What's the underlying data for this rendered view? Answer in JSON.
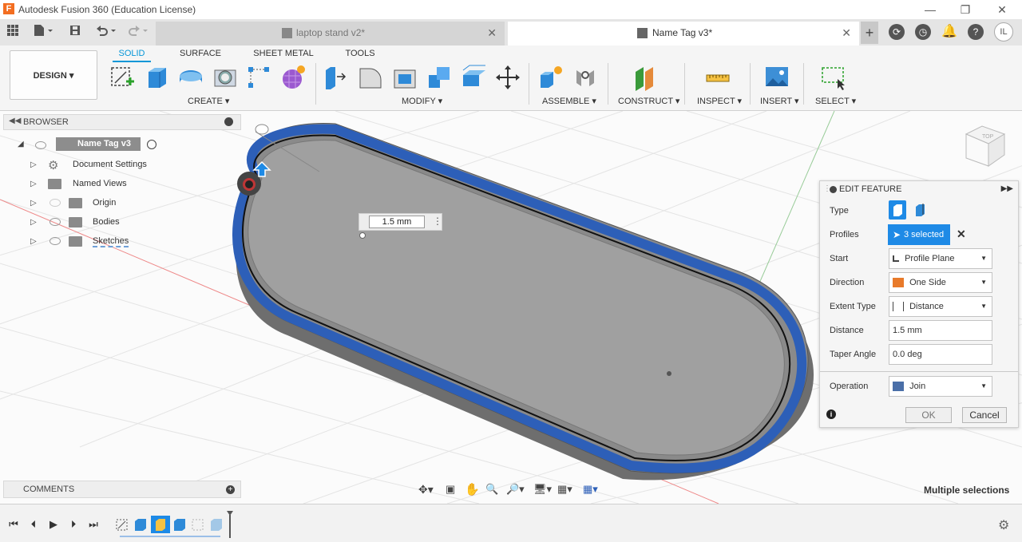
{
  "window": {
    "title": "Autodesk Fusion 360 (Education License)",
    "app_icon": "F"
  },
  "tabs": [
    {
      "label": "laptop stand v2*",
      "active": false
    },
    {
      "label": "Name Tag v3*",
      "active": true
    }
  ],
  "user_initials": "IL",
  "toolbar": {
    "workspace": "DESIGN",
    "workspace_tabs": [
      "SOLID",
      "SURFACE",
      "SHEET METAL",
      "TOOLS"
    ],
    "groups": [
      "CREATE",
      "MODIFY",
      "ASSEMBLE",
      "CONSTRUCT",
      "INSPECT",
      "INSERT",
      "SELECT"
    ]
  },
  "browser": {
    "header": "BROWSER",
    "root": "Name Tag v3",
    "items": [
      "Document Settings",
      "Named Views",
      "Origin",
      "Bodies",
      "Sketches"
    ]
  },
  "comments": {
    "header": "COMMENTS"
  },
  "dimension_input": "1.5 mm",
  "edit_feature": {
    "title": "EDIT FEATURE",
    "labels": {
      "type": "Type",
      "profiles": "Profiles",
      "start": "Start",
      "direction": "Direction",
      "extent_type": "Extent Type",
      "distance": "Distance",
      "taper_angle": "Taper Angle",
      "operation": "Operation"
    },
    "values": {
      "profiles": "3 selected",
      "start": "Profile Plane",
      "direction": "One Side",
      "extent_type": "Distance",
      "distance": "1.5 mm",
      "taper_angle": "0.0 deg",
      "operation": "Join"
    },
    "ok": "OK",
    "cancel": "Cancel"
  },
  "status_text": "Multiple selections",
  "colors": {
    "accent": "#0696d7",
    "selection_blue": "#2d5fb8",
    "body_gray": "#9b9b9b"
  }
}
